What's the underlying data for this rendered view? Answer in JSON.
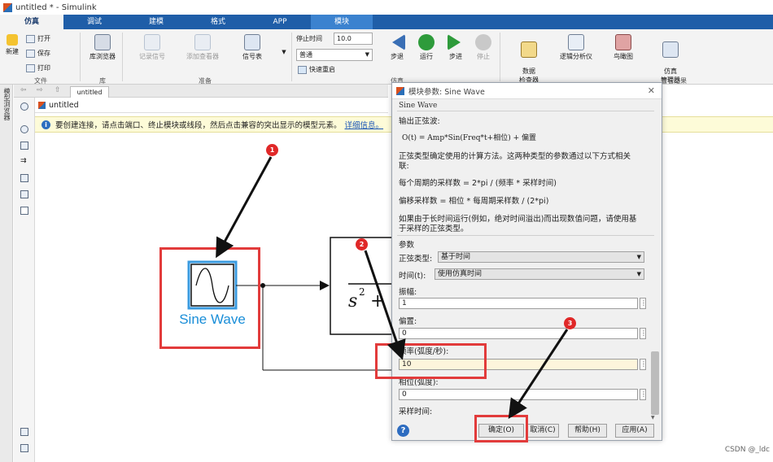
{
  "window": {
    "title": "untitled * - Simulink"
  },
  "tabs": [
    "仿真",
    "调试",
    "建模",
    "格式",
    "APP",
    "模块"
  ],
  "ribbon": {
    "new_label": "新建",
    "open_label": "打开",
    "save_label": "保存",
    "print_label": "打印",
    "file_group": "文件",
    "library_browser": "库浏览器",
    "library_group": "库",
    "log_signals": "记录信号",
    "add_viewer": "添加查看器",
    "signal_table": "信号表",
    "prepare_group": "准备",
    "stop_time_label": "停止时间",
    "stop_time_value": "10.0",
    "mode_value": "普通",
    "fast_restart": "快速重启",
    "step_back": "步退",
    "run": "运行",
    "step_forward": "步进",
    "stop": "停止",
    "simulate_group": "仿真",
    "data_inspector": "数据\n检查器",
    "logic_analyzer": "逻辑分析仪",
    "birds_eye": "鸟瞰图",
    "sim_manager": "仿真\n管理器",
    "review_group": "查看结果"
  },
  "left_strip": {
    "label": "模型浏览器"
  },
  "editor": {
    "tab_label": "untitled",
    "breadcrumb": "untitled"
  },
  "infobar": {
    "message": "要创建连接，请点击端口、终止模块或线段，然后点击兼容的突出显示的模型元素。",
    "link": "详细信息。"
  },
  "canvas": {
    "sine_wave_label": "Sine Wave"
  },
  "dialog": {
    "title": "模块参数: Sine Wave",
    "section": "Sine Wave",
    "line1": "输出正弦波:",
    "formula": "O(t) = Amp*Sin(Freq*t+相位) + 偏置",
    "line2": "正弦类型确定使用的计算方法。这两种类型的参数通过以下方式相关",
    "line2b": "联:",
    "line3": "每个周期的采样数 = 2*pi / (频率 * 采样时间)",
    "line4": "偏移采样数 = 相位 * 每周期采样数 / (2*pi)",
    "line5": "如果由于长时间运行(例如，绝对时间溢出)而出现数值问题，请使用基",
    "line5b": "于采样的正弦类型。",
    "params_label": "参数",
    "sine_type_label": "正弦类型:",
    "sine_type_value": "基于时间",
    "time_label": "时间(t):",
    "time_value": "使用仿真时间",
    "amplitude_label": "振幅:",
    "amplitude_value": "1",
    "bias_label": "偏置:",
    "bias_value": "0",
    "frequency_label": "频率(弧度/秒):",
    "frequency_value": "10",
    "phase_label": "相位(弧度):",
    "phase_value": "0",
    "sample_time_label": "采样时间:",
    "ok_label": "确定(O)",
    "cancel_label": "取消(C)",
    "help_label": "帮助(H)",
    "apply_label": "应用(A)"
  },
  "annotations": [
    "1",
    "2",
    "3"
  ],
  "watermark": "CSDN @_ldc",
  "colors": {
    "ribbon_blue": "#1f5ea8",
    "annotation_red": "#e23b3b",
    "sine_label_blue": "#1a8ed8"
  }
}
